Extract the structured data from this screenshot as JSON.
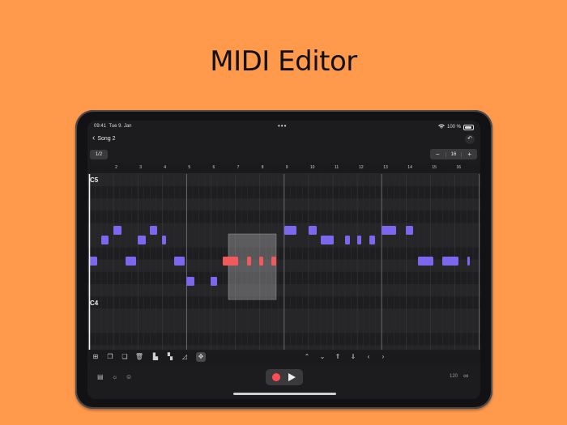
{
  "headline": "MIDI Editor",
  "status_bar": {
    "time": "09:41",
    "date": "Tue 9. Jan",
    "dots": "•••",
    "wifi_icon": "wifi-icon",
    "battery": "100 %",
    "battery_icon": "battery-icon"
  },
  "nav": {
    "back_icon": "chevron-left-icon",
    "back_label": "Song 2",
    "undo_icon": "undo-icon",
    "undo_glyph": "↶"
  },
  "quantize": {
    "label": "1/2"
  },
  "stepper": {
    "minus": "−",
    "value": "16",
    "plus": "+"
  },
  "ruler": {
    "bars": [
      "2",
      "3",
      "4",
      "5",
      "6",
      "7",
      "8",
      "9",
      "10",
      "11",
      "12",
      "13",
      "14",
      "15",
      "16"
    ]
  },
  "piano_roll": {
    "octave_labels": [
      "C5",
      "C4"
    ],
    "colors": {
      "note": "#7B68EE",
      "selected": "#F05A5A",
      "background": "#232325",
      "selection_box": "#cfcfd4"
    }
  },
  "toolbar": {
    "tools": [
      {
        "icon": "add-note-icon",
        "glyph": "⊞"
      },
      {
        "icon": "duplicate-icon",
        "glyph": "❐"
      },
      {
        "icon": "copy-icon",
        "glyph": "❏"
      },
      {
        "icon": "trash-icon",
        "glyph": "🗑"
      },
      {
        "icon": "align-icon",
        "glyph": "▙"
      },
      {
        "icon": "legato-icon",
        "glyph": "▚"
      },
      {
        "icon": "velocity-icon",
        "glyph": "◿"
      },
      {
        "icon": "move-icon",
        "glyph": "✥"
      },
      {
        "icon": "chevron-up-icon",
        "glyph": "⌃"
      },
      {
        "icon": "chevron-down-icon",
        "glyph": "⌄"
      },
      {
        "icon": "octave-up-icon",
        "glyph": "⇑"
      },
      {
        "icon": "octave-down-icon",
        "glyph": "⇓"
      },
      {
        "icon": "chevron-left-icon",
        "glyph": "‹"
      },
      {
        "icon": "chevron-right-icon",
        "glyph": "›"
      }
    ]
  },
  "transport": {
    "left_icons": [
      {
        "icon": "piano-icon",
        "glyph": "▤"
      },
      {
        "icon": "metronome-icon",
        "glyph": "☼"
      },
      {
        "icon": "tuner-icon",
        "glyph": "☺"
      }
    ],
    "record_icon": "record-icon",
    "play_icon": "play-icon",
    "tempo": "120",
    "loop_icon": "loop-icon",
    "loop_glyph": "∞"
  }
}
